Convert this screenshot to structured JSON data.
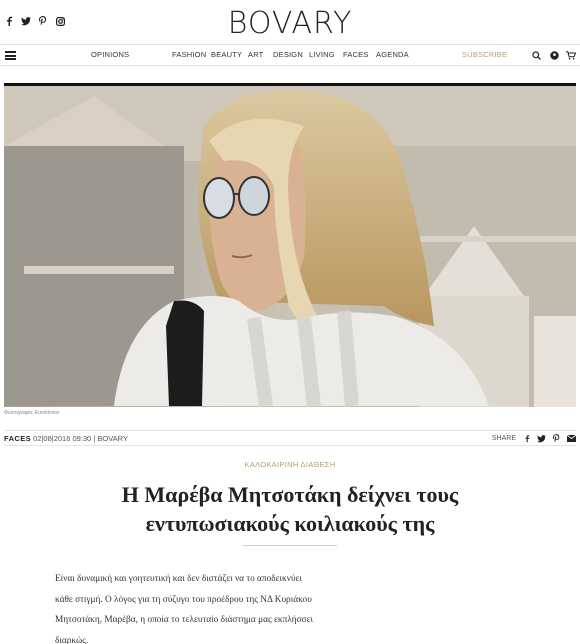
{
  "brand": {
    "logo": "BOVARY"
  },
  "social": [
    "facebook-icon",
    "twitter-icon",
    "pinterest-icon",
    "instagram-icon"
  ],
  "nav": {
    "items": [
      "OPINIONS",
      "FASHION",
      "BEAUTY",
      "ART",
      "DESIGN",
      "LIVING",
      "FACES",
      "AGENDA"
    ],
    "subscribe": "SUBSCRIBE"
  },
  "photo": {
    "credit": "Φωτογραφία: Eurokinissi"
  },
  "meta": {
    "category": "FACES",
    "datetime": "02|08|2016 09:30",
    "separator": "|",
    "source": "BOVARY",
    "share": "SHARE"
  },
  "article": {
    "kicker": "ΚΑΛΟΚΑΙΡΙΝΗ ΔΙΑΘΕΣΗ",
    "title_line1": "Η Μαρέβα Μητσοτάκη δείχνει τους",
    "title_line2": "εντυπωσιακούς κοιλιακούς της",
    "lead_line1": "Είναι δυναμική και γοητευτική και δεν διστάζει να το αποδεικνύει",
    "lead_line2": "κάθε στιγμή. Ο λόγος για τη σύζυγο του προέδρου της ΝΔ Κυριάκου",
    "lead_line3": "Μητσοτάκη, Μαρέβα, η οποία το τελευταίο διάστημα μας εκπλήσσει",
    "lead_line4": "διαρκώς."
  },
  "colors": {
    "accent": "#b89a73",
    "text": "#222222"
  }
}
